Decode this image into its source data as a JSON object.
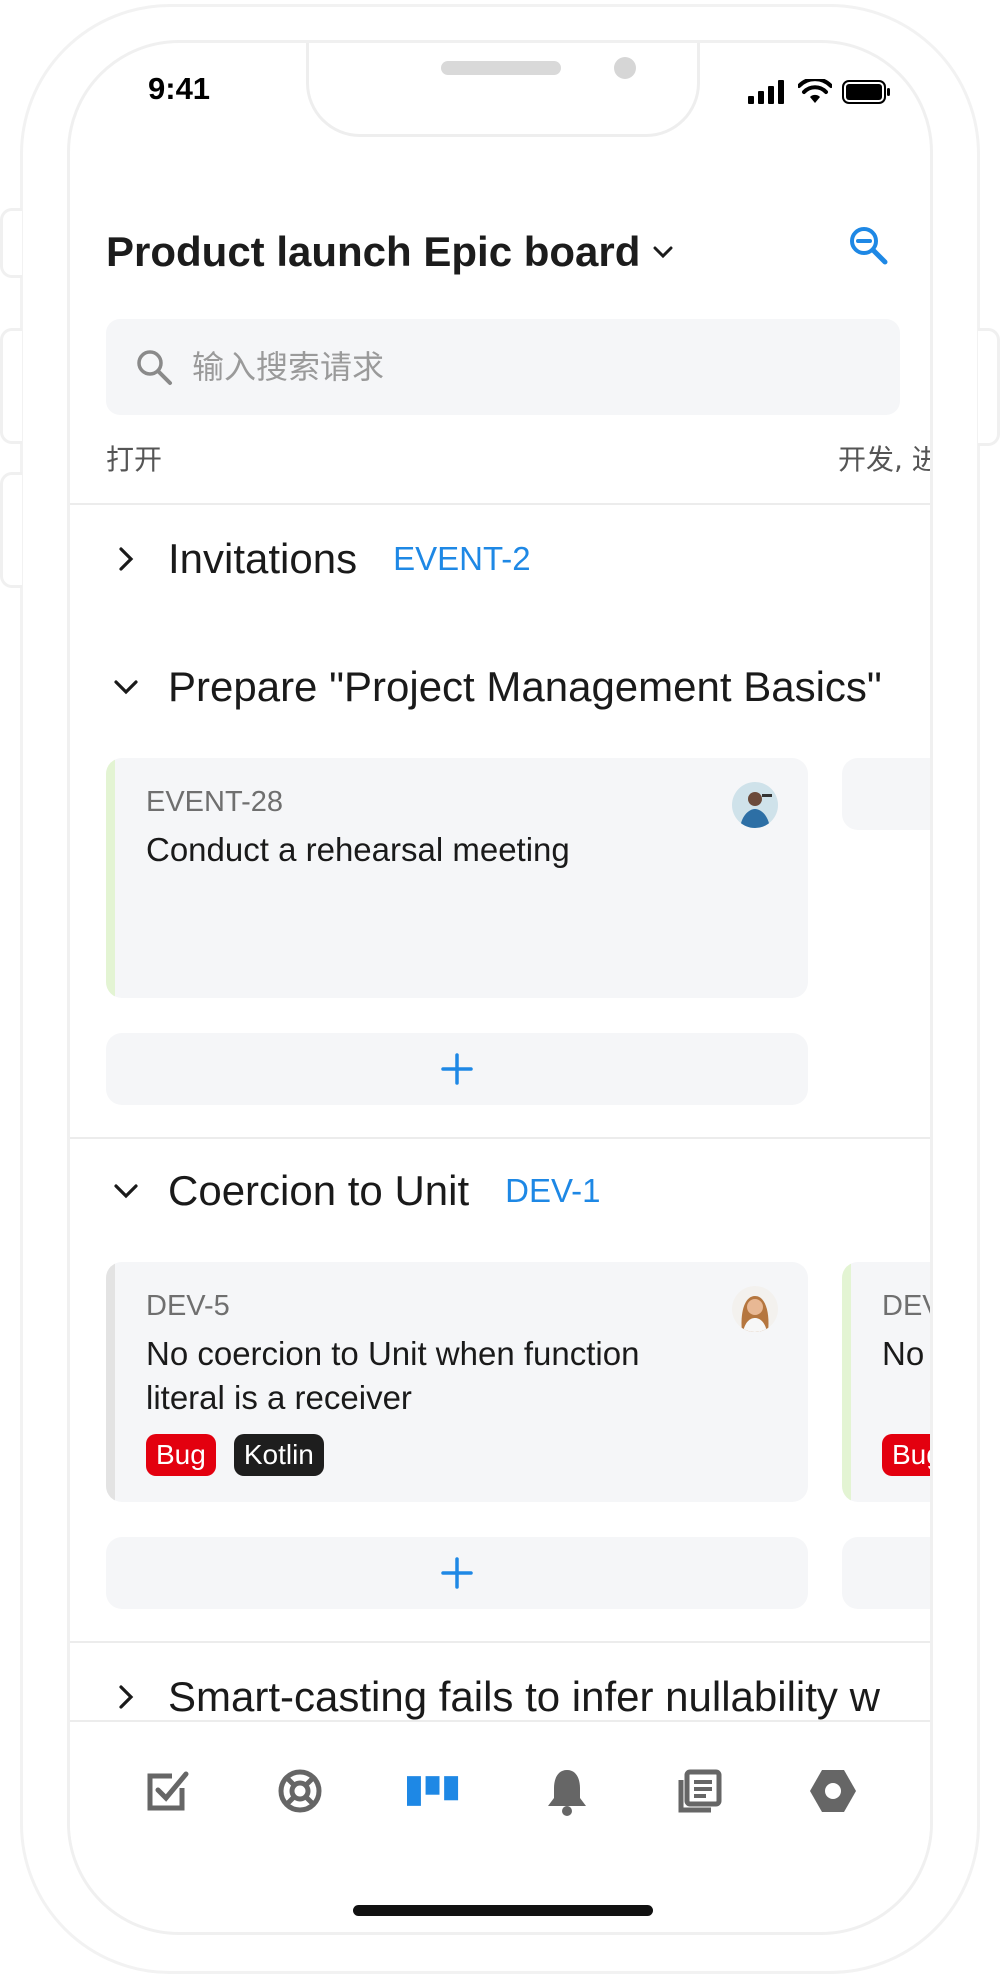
{
  "status_bar": {
    "time": "9:41"
  },
  "header": {
    "title": "Product launch Epic board"
  },
  "search": {
    "placeholder": "输入搜索请求"
  },
  "columns": {
    "left": "打开",
    "right": "开发, 进"
  },
  "swimlanes": [
    {
      "name": "Invitations",
      "key": "EVENT-2",
      "expanded": false
    },
    {
      "name": "Prepare \"Project Management Basics\"",
      "key": "",
      "expanded": true,
      "cards": [
        {
          "key": "EVENT-28",
          "title": "Conduct a rehearsal meeting",
          "bar_color": "#e3f4d3",
          "tags": []
        }
      ]
    },
    {
      "name": "Coercion to Unit",
      "key": "DEV-1",
      "expanded": true,
      "cards": [
        {
          "key": "DEV-5",
          "title": "No coercion to Unit when function literal is a receiver",
          "bar_color": "#e3e3e3",
          "tags": [
            "Bug",
            "Kotlin"
          ]
        },
        {
          "key": "DEV",
          "title": "No arg",
          "bar_color": "#e3f4d3",
          "tags": [
            "Bug"
          ]
        }
      ]
    },
    {
      "name": "Smart-casting fails to infer nullability w",
      "key": "",
      "expanded": false
    }
  ],
  "add_label": "+",
  "nav": [
    "checkbox-icon",
    "lifebuoy-icon",
    "board-icon",
    "bell-icon",
    "articles-icon",
    "hexagon-icon"
  ],
  "colors": {
    "accent": "#1e88e5",
    "bug": "#e3000f",
    "kotlin": "#1e1e1e"
  }
}
